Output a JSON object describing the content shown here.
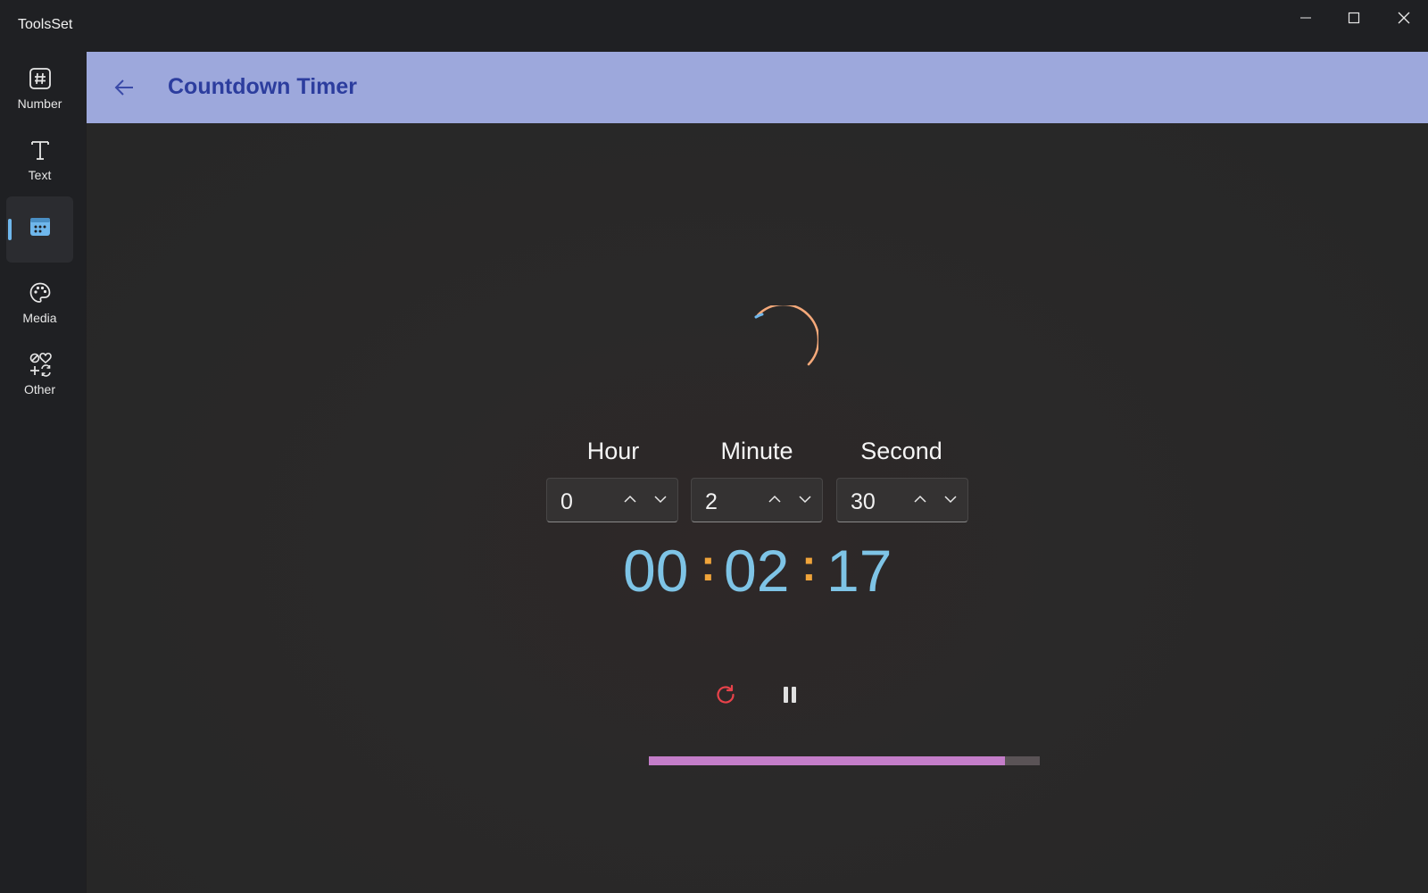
{
  "window": {
    "title": "ToolsSet",
    "minimize_icon": "minimize-icon",
    "maximize_icon": "maximize-icon",
    "close_icon": "close-icon"
  },
  "sidebar": {
    "items": [
      {
        "label": "Number",
        "icon": "hash-icon"
      },
      {
        "label": "Text",
        "icon": "text-t-icon"
      },
      {
        "label": "",
        "icon": "calendar-icon",
        "selected": true
      },
      {
        "label": "Media",
        "icon": "palette-icon"
      },
      {
        "label": "Other",
        "icon": "symbols-icon"
      }
    ],
    "indicator_color": "#6fb7ec"
  },
  "header": {
    "title": "Countdown Timer",
    "back_icon": "back-arrow-icon",
    "background": "#9da8dc",
    "title_color": "#2c3d9e"
  },
  "timer": {
    "fields": [
      {
        "label": "Hour",
        "value": "0"
      },
      {
        "label": "Minute",
        "value": "2"
      },
      {
        "label": "Second",
        "value": "30"
      }
    ],
    "display": {
      "hours": "00",
      "minutes": "02",
      "seconds": "17",
      "separator": ":"
    },
    "digit_color": "#7ec4e6",
    "separator_color": "#f0a43a",
    "controls": {
      "reset_icon": "reset-icon",
      "pause_icon": "pause-icon"
    },
    "progress": {
      "value": 0.91,
      "fill_color": "#c47dc9",
      "track_color": "#5a5356"
    },
    "spinner_color": "#f5a97a"
  }
}
